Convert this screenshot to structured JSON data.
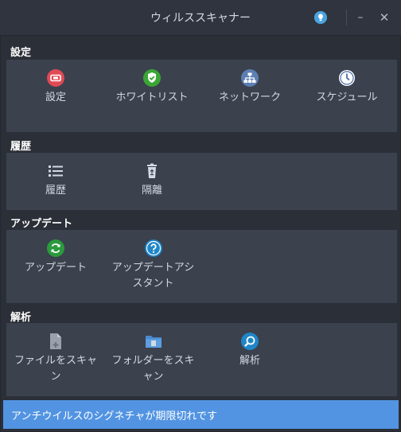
{
  "window": {
    "title": "ウィルススキャナー",
    "minimize_glyph": "–",
    "close_glyph": "✕"
  },
  "sections": {
    "settings": {
      "heading": "設定",
      "items": [
        "設定",
        "ホワイトリスト",
        "ネットワーク",
        "スケジュール"
      ]
    },
    "history": {
      "heading": "履歴",
      "items": [
        "履歴",
        "隔離"
      ]
    },
    "update": {
      "heading": "アップデート",
      "items": [
        "アップデート",
        "アップデートアシスタント"
      ]
    },
    "analysis": {
      "heading": "解析",
      "items": [
        "ファイルをスキャン",
        "フォルダーをスキャン",
        "解析"
      ]
    }
  },
  "status": {
    "message": "アンチウイルスのシグネチャが期限切れです"
  },
  "colors": {
    "accent": "#5294e2",
    "settings_icon": "#e04a55",
    "whitelist_icon": "#3aa635",
    "network_icon": "#5c7fb3",
    "update_icon": "#2b9a3c",
    "help_icon": "#1f86c8"
  },
  "icons": {
    "settings": "settings-icon",
    "whitelist": "shield-check-icon",
    "network": "network-icon",
    "schedule": "clock-icon",
    "history": "list-icon",
    "quarantine": "trash-recycle-icon",
    "update": "refresh-icon",
    "update_assistant": "help-icon",
    "scan_file": "file-add-icon",
    "scan_folder": "folder-icon",
    "analysis": "magnifier-icon",
    "bulb": "lightbulb-icon"
  }
}
